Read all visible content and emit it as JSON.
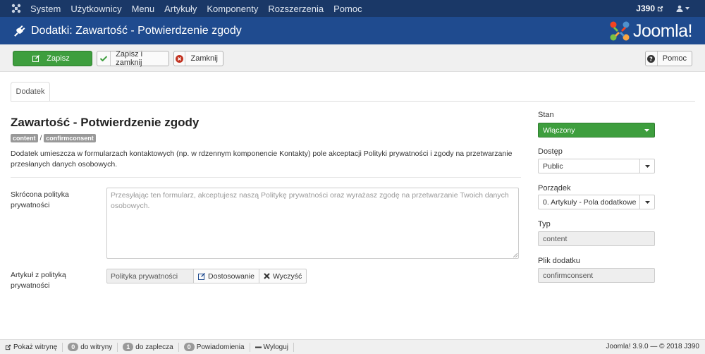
{
  "topbar": {
    "menu": [
      "System",
      "Użytkownicy",
      "Menu",
      "Artykuły",
      "Komponenty",
      "Rozszerzenia",
      "Pomoc"
    ],
    "site_name": "J390"
  },
  "header": {
    "title": "Dodatki: Zawartość - Potwierdzenie zgody",
    "brand": "Joomla!"
  },
  "toolbar": {
    "save": "Zapisz",
    "save_close": "Zapisz i zamknij",
    "close": "Zamknij",
    "help": "Pomoc"
  },
  "tabs": [
    "Dodatek"
  ],
  "plugin": {
    "title": "Zawartość - Potwierdzenie zgody",
    "tag_group": "content",
    "tag_element": "confirmconsent",
    "tag_separator": "/",
    "description": "Dodatek umieszcza w formularzach kontaktowych (np. w rdzennym komponencie Kontakty) pole akceptacji Polityki prywatności i zgody na przetwarzanie przesłanych danych osobowych."
  },
  "fields": {
    "short_policy_label": "Skrócona polityka prywatności",
    "short_policy_placeholder": "Przesyłając ten formularz, akceptujesz naszą Politykę prywatności oraz wyrażasz zgodę na przetwarzanie Twoich danych osobowych.",
    "article_label": "Artykuł z polityką prywatności",
    "article_value": "Polityka prywatności",
    "article_select": "Dostosowanie",
    "article_clear": "Wyczyść"
  },
  "sidebar": {
    "status_label": "Stan",
    "status_value": "Włączony",
    "access_label": "Dostęp",
    "access_value": "Public",
    "ordering_label": "Porządek",
    "ordering_value": "0. Artykuły - Pola dodatkowe",
    "type_label": "Typ",
    "type_value": "content",
    "file_label": "Plik dodatku",
    "file_value": "confirmconsent"
  },
  "statusbar": {
    "view_site": "Pokaż witrynę",
    "frontend_count": "0",
    "frontend_label": "do witryny",
    "backend_count": "1",
    "backend_label": "do zaplecza",
    "messages_count": "0",
    "messages_label": "Powiadomienia",
    "logout": "Wyloguj",
    "version": "Joomla! 3.9.0 — © 2018 J390"
  },
  "colors": {
    "topbar": "#1a3867",
    "header": "#1f4b8f",
    "success": "#3e9e3e"
  }
}
